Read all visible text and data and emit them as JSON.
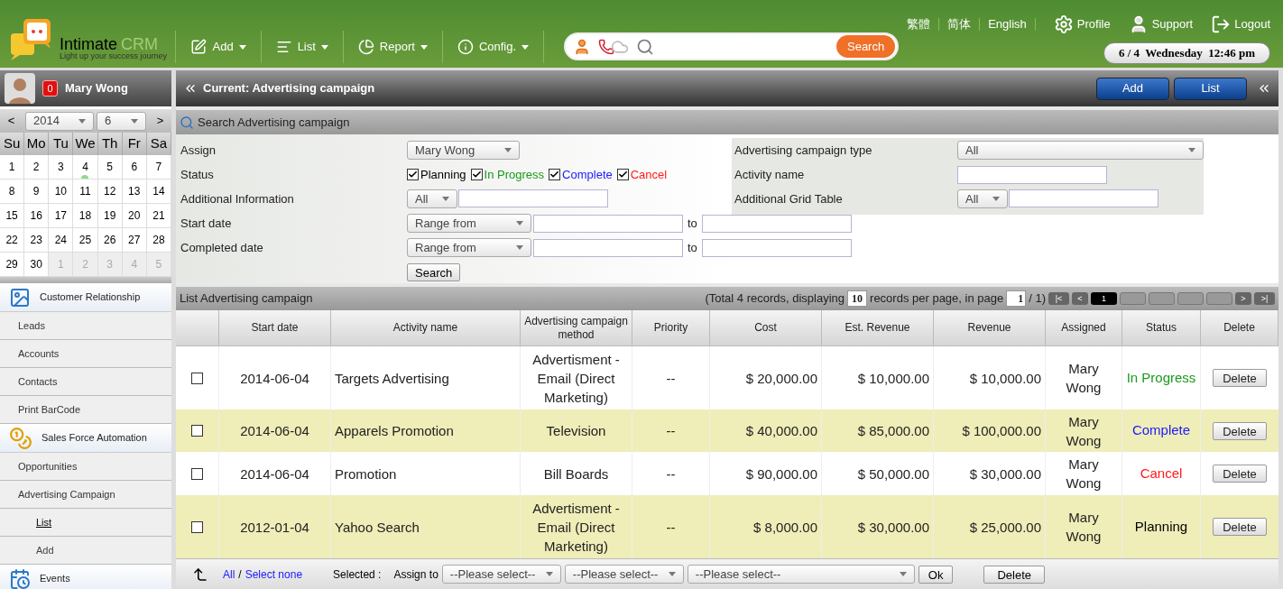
{
  "header": {
    "logo": {
      "name": "Intimate",
      "suffix": "CRM",
      "tagline": "Light up your success journey"
    },
    "languages": [
      "繁體",
      "简体",
      "English"
    ],
    "links": [
      {
        "kind": "profile",
        "label": "Profile"
      },
      {
        "kind": "support",
        "label": "Support"
      },
      {
        "kind": "logout",
        "label": "Logout"
      }
    ],
    "menu": [
      {
        "kind": "add",
        "label": "Add"
      },
      {
        "kind": "list",
        "label": "List"
      },
      {
        "kind": "report",
        "label": "Report"
      },
      {
        "kind": "config",
        "label": "Config."
      }
    ],
    "search_button": "Search",
    "datetime": "6 / 4  Wednesday  12:46 pm"
  },
  "user": {
    "name": "Mary Wong",
    "notifications": "0"
  },
  "calendar": {
    "prev": "<",
    "next": ">",
    "year": "2014",
    "month": "6",
    "weekdays": [
      "Su",
      "Mo",
      "Tu",
      "We",
      "Th",
      "Fr",
      "Sa"
    ],
    "weeks": [
      [
        {
          "day": "1",
          "other_month": false,
          "today": false
        },
        {
          "day": "2",
          "other_month": false,
          "today": false
        },
        {
          "day": "3",
          "other_month": false,
          "today": false
        },
        {
          "day": "4",
          "other_month": false,
          "today": true
        },
        {
          "day": "5",
          "other_month": false,
          "today": false
        },
        {
          "day": "6",
          "other_month": false,
          "today": false
        },
        {
          "day": "7",
          "other_month": false,
          "today": false
        }
      ],
      [
        {
          "day": "8",
          "other_month": false,
          "today": false
        },
        {
          "day": "9",
          "other_month": false,
          "today": false
        },
        {
          "day": "10",
          "other_month": false,
          "today": false
        },
        {
          "day": "11",
          "other_month": false,
          "today": false
        },
        {
          "day": "12",
          "other_month": false,
          "today": false
        },
        {
          "day": "13",
          "other_month": false,
          "today": false
        },
        {
          "day": "14",
          "other_month": false,
          "today": false
        }
      ],
      [
        {
          "day": "15",
          "other_month": false,
          "today": false
        },
        {
          "day": "16",
          "other_month": false,
          "today": false
        },
        {
          "day": "17",
          "other_month": false,
          "today": false
        },
        {
          "day": "18",
          "other_month": false,
          "today": false
        },
        {
          "day": "19",
          "other_month": false,
          "today": false
        },
        {
          "day": "20",
          "other_month": false,
          "today": false
        },
        {
          "day": "21",
          "other_month": false,
          "today": false
        }
      ],
      [
        {
          "day": "22",
          "other_month": false,
          "today": false
        },
        {
          "day": "23",
          "other_month": false,
          "today": false
        },
        {
          "day": "24",
          "other_month": false,
          "today": false
        },
        {
          "day": "25",
          "other_month": false,
          "today": false
        },
        {
          "day": "26",
          "other_month": false,
          "today": false
        },
        {
          "day": "27",
          "other_month": false,
          "today": false
        },
        {
          "day": "28",
          "other_month": false,
          "today": false
        }
      ],
      [
        {
          "day": "29",
          "other_month": false,
          "today": false
        },
        {
          "day": "30",
          "other_month": false,
          "today": false
        },
        {
          "day": "1",
          "other_month": true,
          "today": false
        },
        {
          "day": "2",
          "other_month": true,
          "today": false
        },
        {
          "day": "3",
          "other_month": true,
          "today": false
        },
        {
          "day": "4",
          "other_month": true,
          "today": false
        },
        {
          "day": "5",
          "other_month": true,
          "today": false
        }
      ]
    ]
  },
  "sidebar": {
    "items": [
      {
        "kind": "section",
        "label": "Customer Relationship",
        "selected": false
      },
      {
        "kind": "item",
        "label": "Leads",
        "selected": false
      },
      {
        "kind": "item",
        "label": "Accounts",
        "selected": false
      },
      {
        "kind": "item",
        "label": "Contacts",
        "selected": false
      },
      {
        "kind": "item",
        "label": "Print BarCode",
        "selected": false
      },
      {
        "kind": "section",
        "label": "Sales Force Automation",
        "selected": false
      },
      {
        "kind": "item",
        "label": "Opportunities",
        "selected": false
      },
      {
        "kind": "item",
        "label": "Advertising Campaign",
        "selected": false
      },
      {
        "kind": "subitem",
        "label": "List",
        "selected": true
      },
      {
        "kind": "subitem",
        "label": "Add",
        "selected": false
      },
      {
        "kind": "section",
        "label": "Events",
        "selected": false
      }
    ]
  },
  "page": {
    "title": "Current: Advertising campaign",
    "buttons": [
      "Add",
      "List"
    ]
  },
  "search": {
    "title": "Search Advertising campaign",
    "assign": {
      "label": "Assign",
      "value": "Mary Wong"
    },
    "status": {
      "label": "Status",
      "options": [
        {
          "label": "Planning",
          "checked": true,
          "color": "#000000"
        },
        {
          "label": "In Progress",
          "checked": true,
          "color": "#1a9a1a"
        },
        {
          "label": "Complete",
          "checked": true,
          "color": "#1a1aff"
        },
        {
          "label": "Cancel",
          "checked": true,
          "color": "#ff1a1a"
        }
      ]
    },
    "additional_info": {
      "label": "Additional Information",
      "value": "All"
    },
    "start_date": {
      "label": "Start date",
      "value": "Range from",
      "to": "to"
    },
    "completed_date": {
      "label": "Completed date",
      "value": "Range from",
      "to": "to"
    },
    "campaign_type": {
      "label": "Advertising campaign type",
      "value": "All"
    },
    "activity_name": {
      "label": "Activity name"
    },
    "grid_table": {
      "label": "Additional Grid Table",
      "value": "All"
    },
    "button": "Search"
  },
  "list": {
    "title": "List Advertising campaign",
    "paging": {
      "prefix": "(Total 4 records, displaying",
      "per_page": "10",
      "middle": "records per page, in page",
      "page": "1",
      "suffix": "/ 1)",
      "first": "|<",
      "prev": "<",
      "pages": [
        {
          "label": "1",
          "selected": true
        }
      ],
      "next": ">",
      "last": ">|"
    },
    "columns": [
      "Start date",
      "Activity name",
      "Advertising campaign method",
      "Priority",
      "Cost",
      "Est. Revenue",
      "Revenue",
      "Assigned",
      "Status",
      "Delete"
    ],
    "rows": [
      {
        "checked": false,
        "cells": [
          "2014-06-04",
          "Targets Advertising",
          "Advertisment - Email (Direct Marketing)",
          "--",
          "$ 20,000.00",
          "$ 10,000.00",
          "$ 10,000.00",
          "Mary Wong"
        ],
        "status": "In Progress",
        "color": "#1a9a1a",
        "delete": "Delete"
      },
      {
        "checked": false,
        "cells": [
          "2014-06-04",
          "Apparels Promotion",
          "Television",
          "--",
          "$ 40,000.00",
          "$ 85,000.00",
          "$ 100,000.00",
          "Mary Wong"
        ],
        "status": "Complete",
        "color": "#1a1aff",
        "delete": "Delete"
      },
      {
        "checked": false,
        "cells": [
          "2014-06-04",
          "Promotion",
          "Bill Boards",
          "--",
          "$ 90,000.00",
          "$ 50,000.00",
          "$ 30,000.00",
          "Mary Wong"
        ],
        "status": "Cancel",
        "color": "#ff1a1a",
        "delete": "Delete"
      },
      {
        "checked": false,
        "cells": [
          "2012-01-04",
          "Yahoo Search",
          "Advertisment - Email (Direct Marketing)",
          "--",
          "$ 8,000.00",
          "$ 30,000.00",
          "$ 25,000.00",
          "Mary Wong"
        ],
        "status": "Planning",
        "color": "#000000",
        "delete": "Delete"
      }
    ],
    "footer": {
      "all": "All",
      "separator": "/",
      "select_none": "Select none",
      "selected_label": "Selected :",
      "assign_label": "Assign to",
      "selects": [
        "--Please select--",
        "--Please select--",
        "--Please select--"
      ],
      "ok": "Ok",
      "delete": "Delete"
    }
  }
}
